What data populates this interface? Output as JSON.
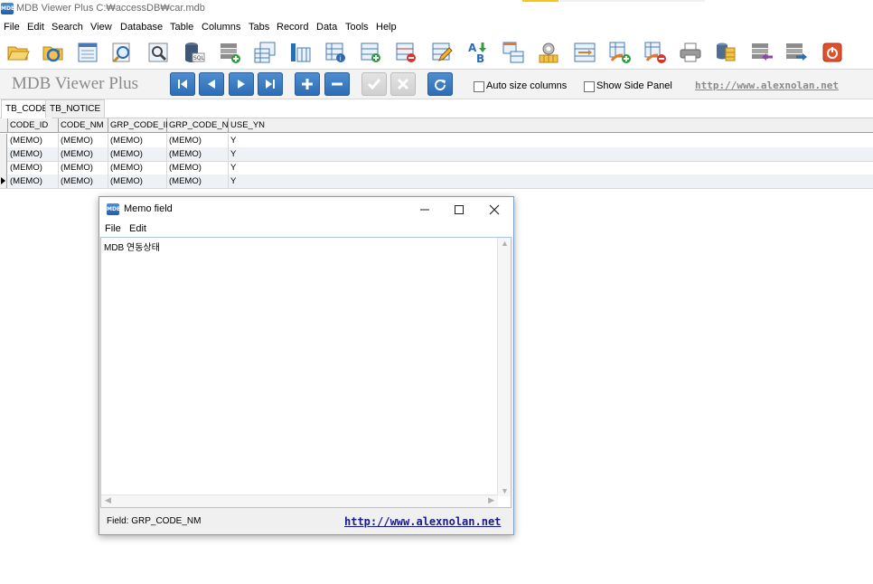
{
  "window": {
    "title": "MDB Viewer Plus C:₩accessDB₩car.mdb",
    "app_icon": "mdb-app-icon"
  },
  "menu": [
    "File",
    "Edit",
    "Search",
    "View",
    "Database",
    "Table",
    "Columns",
    "Tabs",
    "Record",
    "Data",
    "Tools",
    "Help"
  ],
  "toolbar": {
    "icons": [
      "open-folder-icon",
      "reload-icon",
      "table-view-icon",
      "search-doc-icon",
      "query-icon",
      "sql-icon",
      "add-table-icon",
      "tables-icon",
      "columns-icon",
      "table-info-icon",
      "add-row-icon",
      "delete-row-icon",
      "edit-icon",
      "sort-ab-icon",
      "grid-export-icon",
      "settings-icon",
      "merge-icon",
      "table-add-icon",
      "table-delete-icon",
      "print-icon",
      "db-compact-icon",
      "db-import-icon",
      "db-export-icon",
      "exit-icon"
    ]
  },
  "navbar": {
    "brand": "MDB Viewer Plus",
    "buttons": [
      "first-record-icon",
      "prev-record-icon",
      "next-record-icon",
      "last-record-icon",
      "add-record-icon",
      "delete-record-icon",
      "post-edit-icon",
      "cancel-edit-icon",
      "refresh-icon"
    ],
    "auto_size_label": "Auto size columns",
    "side_panel_label": "Show Side Panel",
    "website": "http://www.alexnolan.net"
  },
  "tabs": [
    {
      "label": "TB_CODE",
      "active": true
    },
    {
      "label": "TB_NOTICE",
      "active": false
    }
  ],
  "grid": {
    "columns": [
      "CODE_ID",
      "CODE_NM",
      "GRP_CODE_ID",
      "GRP_CODE_NM",
      "USE_YN"
    ],
    "rows": [
      [
        "(MEMO)",
        "(MEMO)",
        "(MEMO)",
        "(MEMO)",
        "Y"
      ],
      [
        "(MEMO)",
        "(MEMO)",
        "(MEMO)",
        "(MEMO)",
        "Y"
      ],
      [
        "(MEMO)",
        "(MEMO)",
        "(MEMO)",
        "(MEMO)",
        "Y"
      ],
      [
        "(MEMO)",
        "(MEMO)",
        "(MEMO)",
        "(MEMO)",
        "Y"
      ]
    ],
    "current_row": 4
  },
  "memo_dialog": {
    "title": "Memo field",
    "menu": [
      "File",
      "Edit"
    ],
    "content": "MDB 연동상태",
    "field_label": "Field: GRP_CODE_NM",
    "link": "http://www.alexnolan.net",
    "window_buttons": [
      "minimize-icon",
      "maximize-icon",
      "close-icon"
    ]
  }
}
